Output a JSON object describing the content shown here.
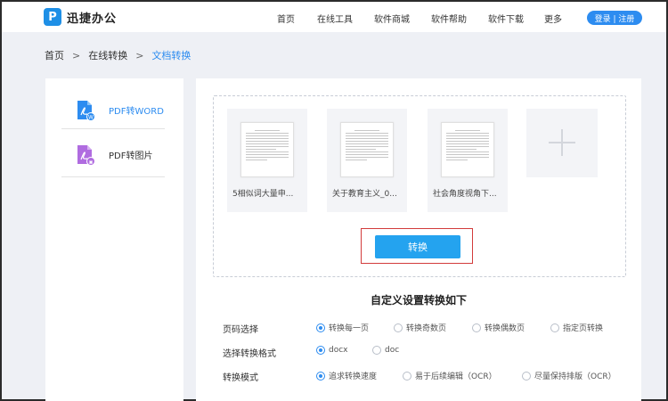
{
  "app": {
    "logo_mark": "P",
    "logo_text": "迅捷办公"
  },
  "nav": {
    "items": [
      "首页",
      "在线工具",
      "软件商城",
      "软件帮助",
      "软件下载",
      "更多"
    ],
    "login_label": "登录 | 注册"
  },
  "breadcrumb": {
    "items": [
      "首页",
      "在线转换",
      "文档转换"
    ],
    "separator": ">"
  },
  "sidebar": {
    "items": [
      {
        "label": "PDF转WORD",
        "icon": "pdf-to-word-icon",
        "color": "#2d8cf0",
        "badge": "W"
      },
      {
        "label": "PDF转图片",
        "icon": "pdf-to-image-icon",
        "color": "#333333",
        "badge": "▣"
      }
    ]
  },
  "files": [
    {
      "name": "5相似词大量申..."
    },
    {
      "name": "关于教育主义_0..."
    },
    {
      "name": "社会角度视角下..."
    }
  ],
  "convert_button": {
    "label": "转换"
  },
  "settings": {
    "title": "自定义设置转换如下",
    "rows": [
      {
        "label": "页码选择",
        "options": [
          "转换每一页",
          "转换奇数页",
          "转换偶数页",
          "指定页转换"
        ],
        "selected": 0
      },
      {
        "label": "选择转换格式",
        "options": [
          "docx",
          "doc"
        ],
        "selected": 0
      },
      {
        "label": "转换模式",
        "options": [
          "追求转换速度",
          "易于后续编辑（OCR）",
          "尽量保持排版（OCR）"
        ],
        "selected": 0
      }
    ]
  },
  "colors": {
    "accent": "#2d8cf0",
    "button": "#24a3ef",
    "highlight": "#d23b3b"
  }
}
